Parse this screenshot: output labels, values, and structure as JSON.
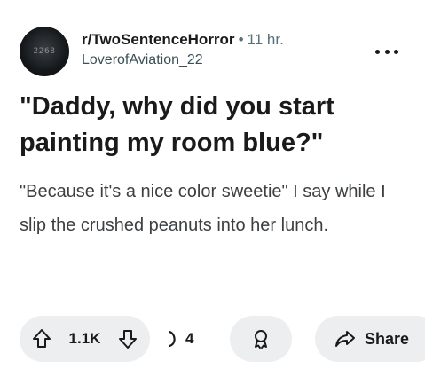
{
  "post": {
    "avatar_text": "2268",
    "subreddit": "r/TwoSentenceHorror",
    "separator": "•",
    "time": "11 hr.",
    "author": "LoverofAviation_22",
    "title": "\"Daddy, why did you start painting my room blue?\"",
    "body": "\"Because it's a nice color sweetie\" I say while I slip the crushed peanuts into her lunch."
  },
  "actions": {
    "vote_count": "1.1K",
    "comment_count": "4",
    "share_label": "Share"
  },
  "icons": {
    "overflow": "more-horizontal-icon",
    "upvote": "arrow-up-icon",
    "downvote": "arrow-down-icon",
    "comment": "comment-bubble-icon",
    "award": "award-icon",
    "share": "share-arrow-icon"
  }
}
